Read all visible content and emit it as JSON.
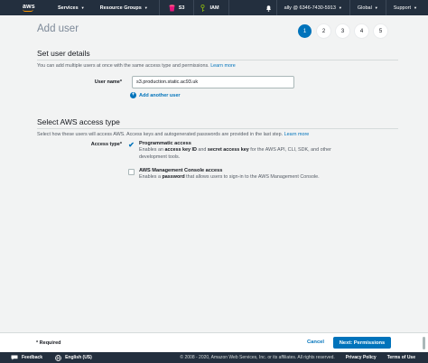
{
  "topnav": {
    "logo_text": "aws",
    "services_label": "Services",
    "resource_groups_label": "Resource Groups",
    "s3_label": "S3",
    "iam_label": "IAM",
    "account_label": "ally @ 6346-7430-5913",
    "region_label": "Global",
    "support_label": "Support"
  },
  "page": {
    "title": "Add user",
    "steps": [
      "1",
      "2",
      "3",
      "4",
      "5"
    ],
    "active_step": "1"
  },
  "user_details": {
    "title": "Set user details",
    "desc": "You can add multiple users at once with the same access type and permissions.",
    "learn_more": "Learn more",
    "user_name_label": "User name*",
    "user_name_value": "s3.production.static.ac93.uk",
    "add_another_label": "Add another user"
  },
  "access_type": {
    "title": "Select AWS access type",
    "desc": "Select how these users will access AWS. Access keys and autogenerated passwords are provided in the last step.",
    "learn_more": "Learn more",
    "label": "Access type*",
    "programmatic": {
      "title": "Programmatic access",
      "desc_prefix": "Enables an ",
      "desc_b1": "access key ID",
      "desc_mid": " and ",
      "desc_b2": "secret access key",
      "desc_suffix": " for the AWS API, CLI, SDK, and other development tools.",
      "checked": true
    },
    "console": {
      "title": "AWS Management Console access",
      "desc_prefix": "Enables a ",
      "desc_b1": "password",
      "desc_suffix": " that allows users to sign-in to the AWS Management Console.",
      "checked": false
    }
  },
  "footer_bar": {
    "required_label": "* Required",
    "cancel_label": "Cancel",
    "next_label": "Next: Permissions"
  },
  "console_footer": {
    "feedback_label": "Feedback",
    "language_label": "English (US)",
    "copyright": "© 2008 - 2020, Amazon Web Services, Inc. or its affiliates. All rights reserved.",
    "privacy_label": "Privacy Policy",
    "terms_label": "Terms of Use"
  },
  "colors": {
    "nav_bg": "#232f3e",
    "accent": "#0073bb",
    "orange": "#ff9900",
    "s3_red": "#e7157b"
  }
}
